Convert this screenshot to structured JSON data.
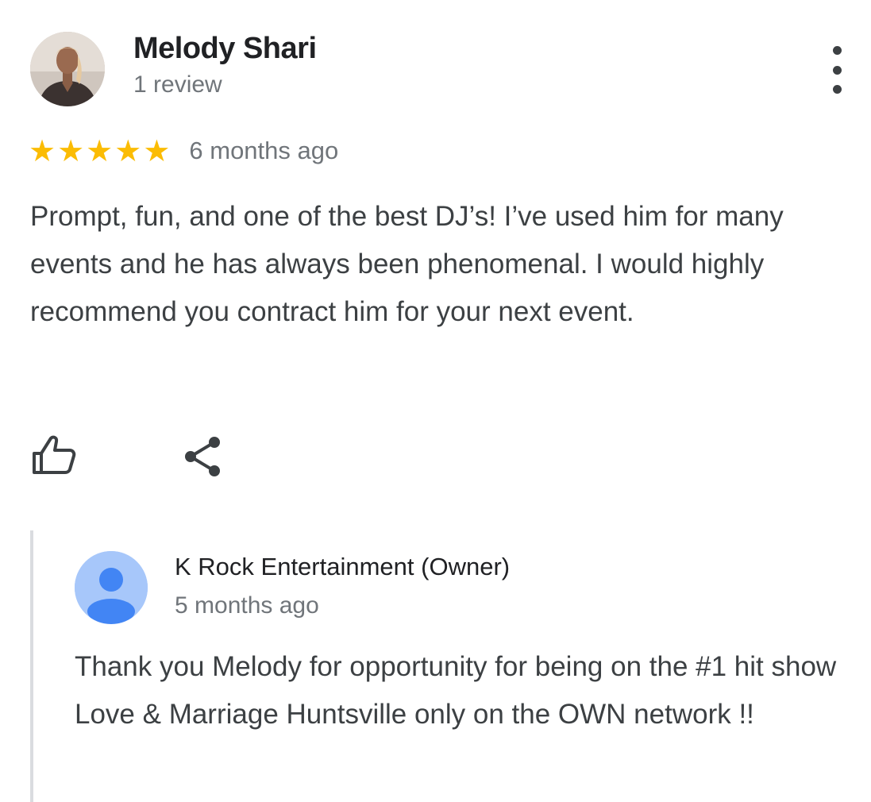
{
  "review": {
    "author_name": "Melody Shari",
    "author_meta": "1 review",
    "rating": 5,
    "stars": [
      "★",
      "★",
      "★",
      "★",
      "★"
    ],
    "date": "6 months ago",
    "text": "Prompt, fun, and one of the best DJ’s! I’ve used him for many events and he has always been phenomenal. I would highly recommend you contract him for your next event.",
    "star_color": "#fbbc04"
  },
  "actions": {
    "like_icon": "thumbs-up-icon",
    "share_icon": "share-icon",
    "more_icon": "more-vertical-icon"
  },
  "owner_reply": {
    "name": "K Rock Entertainment (Owner)",
    "date": "5 months ago",
    "text": "Thank you Melody for opportunity for being on the #1 hit show Love & Marriage Huntsville only on the OWN network !!",
    "avatar_icon": "default-person-icon",
    "avatar_color": "#a7c7fa",
    "avatar_figure_color": "#4285f4"
  }
}
